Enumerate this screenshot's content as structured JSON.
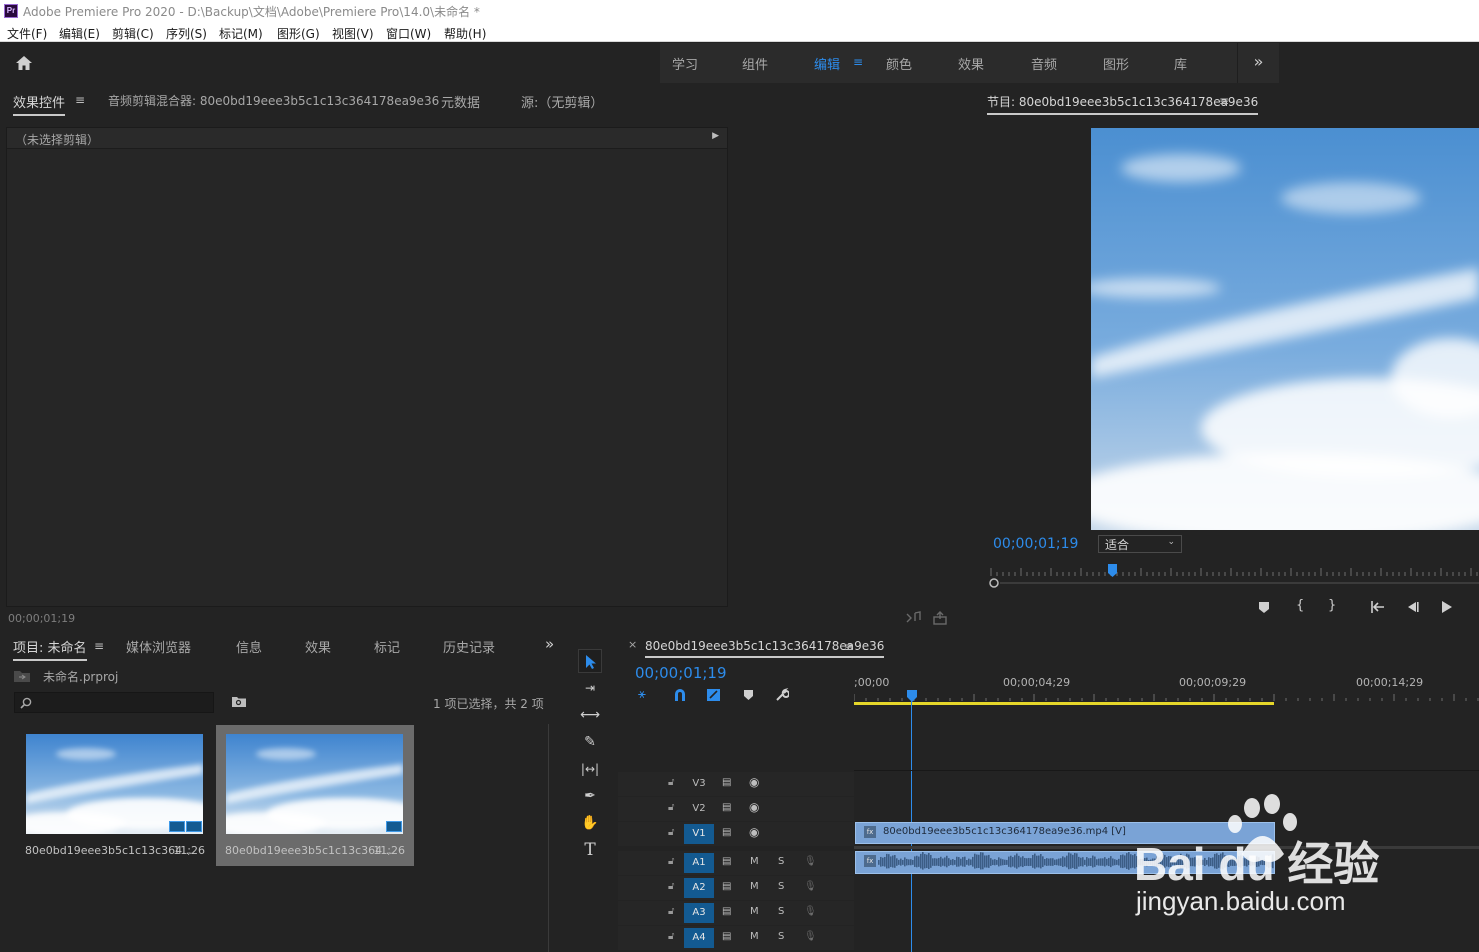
{
  "app": {
    "title": "Adobe Premiere Pro 2020 - D:\\Backup\\文档\\Adobe\\Premiere Pro\\14.0\\未命名 *",
    "logo_text": "Pr"
  },
  "menu": [
    "文件(F)",
    "编辑(E)",
    "剪辑(C)",
    "序列(S)",
    "标记(M)",
    "图形(G)",
    "视图(V)",
    "窗口(W)",
    "帮助(H)"
  ],
  "workspaces": {
    "tabs": [
      "学习",
      "组件",
      "编辑",
      "颜色",
      "效果",
      "音频",
      "图形",
      "库"
    ],
    "active": "编辑",
    "more_glyph": "»"
  },
  "effect_panel": {
    "tabs": [
      "效果控件",
      "音频剪辑混合器: 80e0bd19eee3b5c1c13c364178ea9e36",
      "元数据",
      "源:（无剪辑）"
    ],
    "menu_glyph": "≡",
    "no_clip": "（未选择剪辑）",
    "timecode": "00;00;01;19"
  },
  "program": {
    "title": "节目: 80e0bd19eee3b5c1c13c364178ea9e36",
    "menu_glyph": "≡",
    "timecode": "00;00;01;19",
    "zoom": "适合"
  },
  "project": {
    "tabs": [
      "项目: 未命名",
      "媒体浏览器",
      "信息",
      "效果",
      "标记",
      "历史记录"
    ],
    "menu_glyph": "≡",
    "more_glyph": "»",
    "file": "未命名.prproj",
    "search_placeholder": "",
    "selection_status": "1 项已选择，共 2 项",
    "items": [
      {
        "name": "80e0bd19eee3b5c1c13c364...",
        "duration": "11;26",
        "selected": false
      },
      {
        "name": "80e0bd19eee3b5c1c13c364...",
        "duration": "11;26",
        "selected": true
      }
    ]
  },
  "timeline": {
    "sequence": "80e0bd19eee3b5c1c13c364178ea9e36",
    "close_glyph": "×",
    "menu_glyph": "≡",
    "timecode": "00;00;01;19",
    "ruler": [
      ";00;00",
      "00;00;04;29",
      "00;00;09;29",
      "00;00;14;29"
    ],
    "video_tracks": [
      "V3",
      "V2",
      "V1"
    ],
    "audio_tracks": [
      "A1",
      "A2",
      "A3",
      "A4"
    ],
    "mute_label": "M",
    "solo_label": "S",
    "video_clip": "80e0bd19eee3b5c1c13c364178ea9e36.mp4 [V]",
    "clip_badge": "fx"
  },
  "watermark": {
    "brand": "Bai du 经验",
    "url": "jingyan.baidu.com"
  },
  "colors": {
    "accent": "#2d8ceb",
    "clip": "#7aa3d6",
    "track_on": "#135a91",
    "work_area": "#e5d62a"
  }
}
